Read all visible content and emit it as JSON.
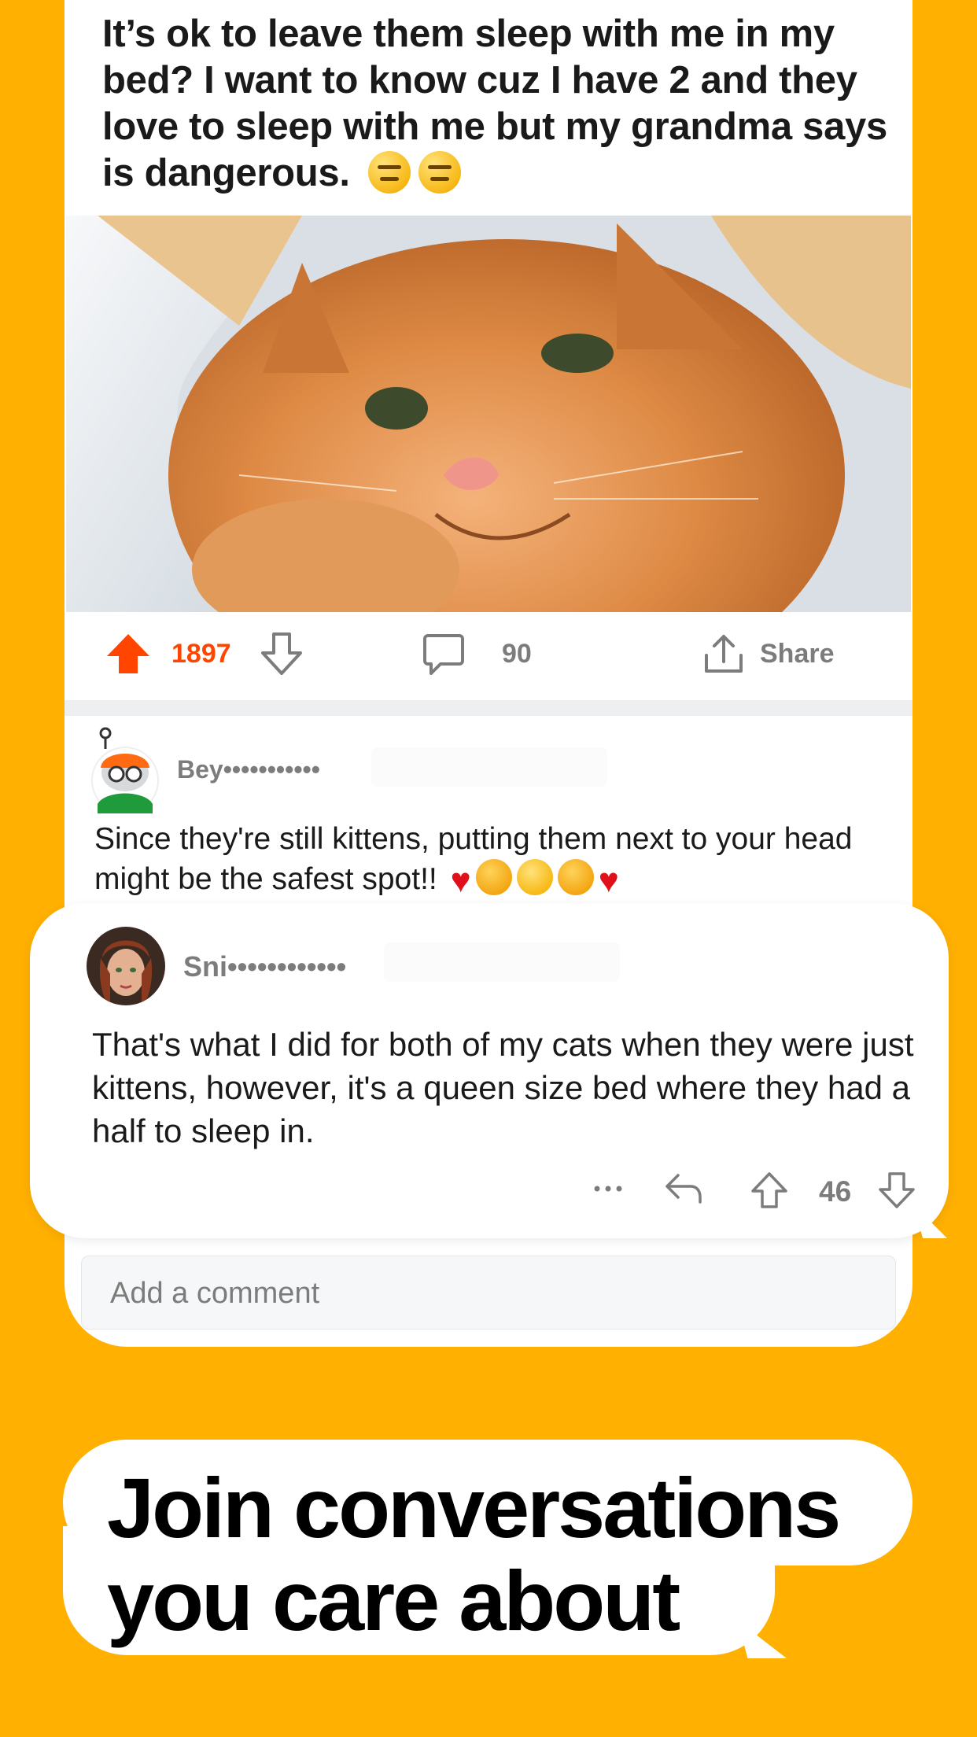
{
  "post": {
    "title": "It’s ok to leave them sleep with me in my bed? I want to know cuz I have 2 and they love to sleep with me but my grandma says is dangerous.",
    "title_emojis": [
      "😑",
      "😑"
    ],
    "image_alt": "orange kitten",
    "upvotes": "1897",
    "comments": "90",
    "share_label": "Share"
  },
  "comment1": {
    "user": "Bey•••••••••••",
    "text": "Since they're still kittens, putting them next to your head might be the safest spot!!",
    "emojis": [
      "❤️",
      "😽",
      "😴",
      "😽",
      "❤️"
    ]
  },
  "comment2": {
    "user": "Sni••••••••••••",
    "text": "That's what I did for both of my cats when they were just kittens, however, it's a queen size bed where they had a half to sleep in.",
    "more": "•••",
    "score": "46"
  },
  "composer": {
    "placeholder": "Add a comment"
  },
  "tagline": {
    "line1": "Join conversations",
    "line2": "you care about"
  },
  "colors": {
    "background": "#FFB000",
    "upvote": "#FF4500",
    "meta_text": "#7C7C7C"
  }
}
